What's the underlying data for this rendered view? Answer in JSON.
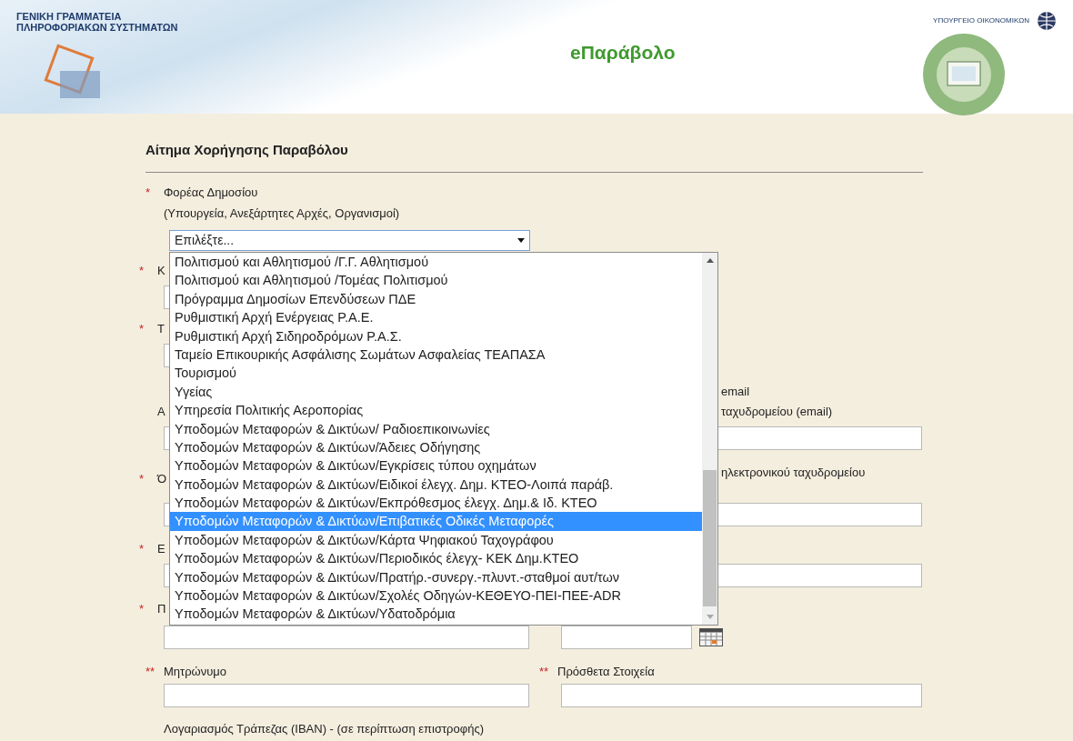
{
  "header": {
    "org_name": [
      "ΓΕΝΙΚΗ ΓΡΑΜΜΑΤΕΙΑ",
      "ΠΛΗΡΟΦΟΡΙΑΚΩΝ ΣΥΣΤΗΜΑΤΩΝ"
    ],
    "app_title": "eΠαράβολο",
    "ministry": "ΥΠΟΥΡΓΕΙΟ ΟΙΚΟΝΟΜΙΚΩΝ"
  },
  "form": {
    "title": "Αίτημα Χορήγησης Παραβόλου",
    "agency": {
      "mark": "*",
      "label": "Φορέας Δημοσίου",
      "hint": "(Υπουργεία, Ανεξάρτητες Αρχές, Οργανισμοί)",
      "value": "Επιλέξτε...",
      "expanded": true,
      "options": [
        {
          "label": "Πολιτισμού και Αθλητισμού /Γ.Γ. Αθλητισμού",
          "selected": false
        },
        {
          "label": "Πολιτισμού και Αθλητισμού /Τομέας Πολιτισμού",
          "selected": false
        },
        {
          "label": "Πρόγραμμα Δημοσίων Επενδύσεων ΠΔΕ",
          "selected": false
        },
        {
          "label": "Ρυθμιστική Αρχή Ενέργειας Ρ.Α.Ε.",
          "selected": false
        },
        {
          "label": "Ρυθμιστική Αρχή Σιδηροδρόμων Ρ.Α.Σ.",
          "selected": false
        },
        {
          "label": "Ταμείο Επικουρικής Ασφάλισης Σωμάτων Ασφαλείας ΤΕΑΠΑΣΑ",
          "selected": false
        },
        {
          "label": "Τουρισμού",
          "selected": false
        },
        {
          "label": "Υγείας",
          "selected": false
        },
        {
          "label": "Υπηρεσία Πολιτικής Αεροπορίας",
          "selected": false
        },
        {
          "label": "Υποδομών Μεταφορών & Δικτύων/ Ραδιοεπικοινωνίες",
          "selected": false
        },
        {
          "label": "Υποδομών Μεταφορών & Δικτύων/Άδειες Οδήγησης",
          "selected": false
        },
        {
          "label": "Υποδομών Μεταφορών & Δικτύων/Εγκρίσεις τύπου οχημάτων",
          "selected": false
        },
        {
          "label": "Υποδομών Μεταφορών & Δικτύων/Ειδικοί έλεγχ. Δημ. ΚΤΕΟ-Λοιπά παράβ.",
          "selected": false
        },
        {
          "label": "Υποδομών Μεταφορών & Δικτύων/Εκπρόθεσμος έλεγχ. Δημ.& Ιδ. ΚΤΕΟ",
          "selected": false
        },
        {
          "label": "Υποδομών Μεταφορών & Δικτύων/Επιβατικές Οδικές Μεταφορές",
          "selected": true
        },
        {
          "label": "Υποδομών Μεταφορών & Δικτύων/Κάρτα Ψηφιακού Ταχογράφου",
          "selected": false
        },
        {
          "label": "Υποδομών Μεταφορών & Δικτύων/Περιοδικός έλεγχ- ΚΕΚ Δημ.ΚΤΕΟ",
          "selected": false
        },
        {
          "label": "Υποδομών Μεταφορών & Δικτύων/Πρατήρ.-συνεργ.-πλυντ.-σταθμοί αυτ/των",
          "selected": false
        },
        {
          "label": "Υποδομών Μεταφορών & Δικτύων/Σχολές Οδηγών-ΚΕΘΕΥΟ-ΠΕΙ-ΠΕΕ-ADR",
          "selected": false
        },
        {
          "label": "Υποδομών Μεταφορών & Δικτύων/Υδατοδρόμια",
          "selected": false
        }
      ]
    },
    "rows": [
      {
        "left": {
          "mark": "*",
          "label": "Κ"
        }
      },
      {
        "left": {
          "mark": "*",
          "label": "Τ"
        }
      },
      {
        "left": {
          "label": "Α"
        },
        "right": {
          "kind": "text",
          "label": "email",
          "sublabel": "ταχυδρομείου (email)"
        }
      },
      {
        "left": {
          "mark": "*",
          "label": "Ό"
        },
        "right": {
          "kind": "text",
          "label": "ηλεκτρονικού ταχυδρομείου"
        }
      },
      {
        "left": {
          "mark": "*",
          "label": "Ε"
        },
        "right": {
          "kind": "text"
        }
      },
      {
        "left": {
          "mark": "*",
          "label": "Π"
        },
        "right": {
          "kind": "date"
        }
      },
      {
        "left": {
          "mark": "**",
          "label": "Μητρώνυμο"
        },
        "right": {
          "kind": "text",
          "mark": "**",
          "label": "Πρόσθετα Στοιχεία"
        }
      }
    ],
    "iban_label": "Λογαριασμός Τράπεζας (IBAN) - (σε περίπτωση επιστροφής)"
  }
}
